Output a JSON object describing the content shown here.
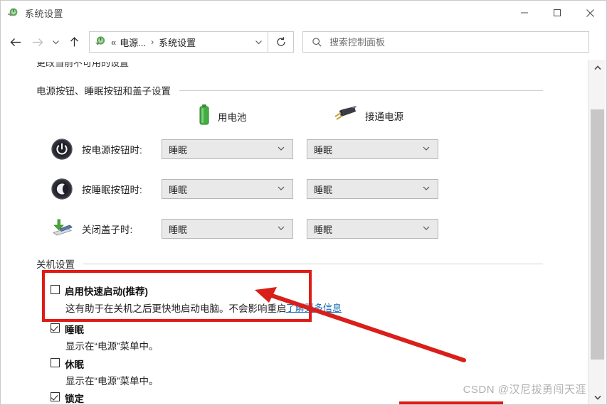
{
  "window": {
    "title": "系统设置",
    "icon": "power-settings-icon",
    "minimize_label": "最小化",
    "maximize_label": "最大化",
    "close_label": "关闭"
  },
  "toolbar": {
    "back_icon": "back-arrow-icon",
    "forward_icon": "forward-arrow-icon",
    "recent_icon": "chevron-down-icon",
    "up_icon": "up-arrow-icon",
    "address": {
      "icon": "power-settings-icon",
      "double_chevron": "«",
      "crumbs": [
        "电源...",
        "系统设置"
      ],
      "separator": "›",
      "dropdown_icon": "chevron-down-icon"
    },
    "refresh_icon": "refresh-icon"
  },
  "search": {
    "icon": "search-icon",
    "placeholder": "搜索控制面板",
    "value": ""
  },
  "content": {
    "partial_top_row": "更改当前不可用的设置",
    "buttons_section": {
      "heading": "电源按钮、睡眠按钮和盖子设置"
    },
    "supplies": [
      {
        "icon": "battery-icon",
        "label": "用电池"
      },
      {
        "icon": "power-plug-icon",
        "label": "接通电源"
      }
    ],
    "settings_rows": [
      {
        "icon": "power-button-icon",
        "label": "按电源按钮时:",
        "battery_value": "睡眠",
        "plugged_value": "睡眠"
      },
      {
        "icon": "sleep-button-icon",
        "label": "按睡眠按钮时:",
        "battery_value": "睡眠",
        "plugged_value": "睡眠"
      },
      {
        "icon": "laptop-lid-icon",
        "label": "关闭盖子时:",
        "battery_value": "睡眠",
        "plugged_value": "睡眠"
      }
    ],
    "shutdown_section": {
      "heading": "关机设置",
      "items": [
        {
          "checked": false,
          "label": "启用快速启动(推荐)",
          "description": "这有助于在关机之后更快地启动电脑。不会影响重启",
          "link": "了解更多信息"
        },
        {
          "checked": true,
          "label": "睡眠",
          "description": "显示在“电源”菜单中。"
        },
        {
          "checked": false,
          "label": "休眠",
          "description": "显示在“电源”菜单中。"
        },
        {
          "checked": true,
          "label": "锁定",
          "description": ""
        }
      ]
    }
  },
  "scrollbar": {
    "up_icon": "scroll-up-arrow-icon",
    "down_icon": "scroll-down-arrow-icon"
  },
  "annotations": {
    "highlight_color": "#e01b16",
    "arrow_color": "#d81f1a",
    "highlight_target": "启用快速启动(推荐)"
  },
  "watermark": {
    "text": "CSDN @汉尼拔勇闯天涯"
  }
}
